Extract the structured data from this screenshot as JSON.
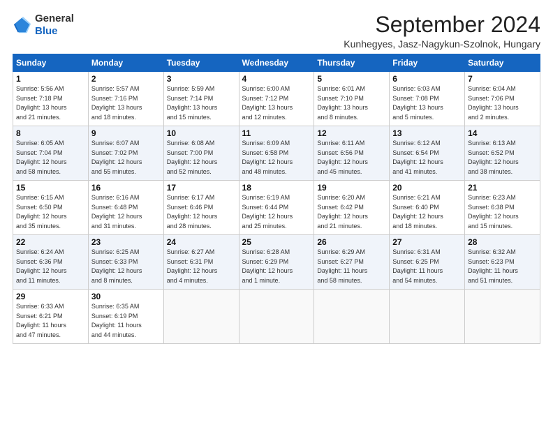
{
  "logo": {
    "line1": "General",
    "line2": "Blue"
  },
  "title": "September 2024",
  "location": "Kunhegyes, Jasz-Nagykun-Szolnok, Hungary",
  "days_of_week": [
    "Sunday",
    "Monday",
    "Tuesday",
    "Wednesday",
    "Thursday",
    "Friday",
    "Saturday"
  ],
  "weeks": [
    [
      {
        "day": "1",
        "sunrise": "5:56 AM",
        "sunset": "7:18 PM",
        "daylight": "13 hours and 21 minutes."
      },
      {
        "day": "2",
        "sunrise": "5:57 AM",
        "sunset": "7:16 PM",
        "daylight": "13 hours and 18 minutes."
      },
      {
        "day": "3",
        "sunrise": "5:59 AM",
        "sunset": "7:14 PM",
        "daylight": "13 hours and 15 minutes."
      },
      {
        "day": "4",
        "sunrise": "6:00 AM",
        "sunset": "7:12 PM",
        "daylight": "13 hours and 12 minutes."
      },
      {
        "day": "5",
        "sunrise": "6:01 AM",
        "sunset": "7:10 PM",
        "daylight": "13 hours and 8 minutes."
      },
      {
        "day": "6",
        "sunrise": "6:03 AM",
        "sunset": "7:08 PM",
        "daylight": "13 hours and 5 minutes."
      },
      {
        "day": "7",
        "sunrise": "6:04 AM",
        "sunset": "7:06 PM",
        "daylight": "13 hours and 2 minutes."
      }
    ],
    [
      {
        "day": "8",
        "sunrise": "6:05 AM",
        "sunset": "7:04 PM",
        "daylight": "12 hours and 58 minutes."
      },
      {
        "day": "9",
        "sunrise": "6:07 AM",
        "sunset": "7:02 PM",
        "daylight": "12 hours and 55 minutes."
      },
      {
        "day": "10",
        "sunrise": "6:08 AM",
        "sunset": "7:00 PM",
        "daylight": "12 hours and 52 minutes."
      },
      {
        "day": "11",
        "sunrise": "6:09 AM",
        "sunset": "6:58 PM",
        "daylight": "12 hours and 48 minutes."
      },
      {
        "day": "12",
        "sunrise": "6:11 AM",
        "sunset": "6:56 PM",
        "daylight": "12 hours and 45 minutes."
      },
      {
        "day": "13",
        "sunrise": "6:12 AM",
        "sunset": "6:54 PM",
        "daylight": "12 hours and 41 minutes."
      },
      {
        "day": "14",
        "sunrise": "6:13 AM",
        "sunset": "6:52 PM",
        "daylight": "12 hours and 38 minutes."
      }
    ],
    [
      {
        "day": "15",
        "sunrise": "6:15 AM",
        "sunset": "6:50 PM",
        "daylight": "12 hours and 35 minutes."
      },
      {
        "day": "16",
        "sunrise": "6:16 AM",
        "sunset": "6:48 PM",
        "daylight": "12 hours and 31 minutes."
      },
      {
        "day": "17",
        "sunrise": "6:17 AM",
        "sunset": "6:46 PM",
        "daylight": "12 hours and 28 minutes."
      },
      {
        "day": "18",
        "sunrise": "6:19 AM",
        "sunset": "6:44 PM",
        "daylight": "12 hours and 25 minutes."
      },
      {
        "day": "19",
        "sunrise": "6:20 AM",
        "sunset": "6:42 PM",
        "daylight": "12 hours and 21 minutes."
      },
      {
        "day": "20",
        "sunrise": "6:21 AM",
        "sunset": "6:40 PM",
        "daylight": "12 hours and 18 minutes."
      },
      {
        "day": "21",
        "sunrise": "6:23 AM",
        "sunset": "6:38 PM",
        "daylight": "12 hours and 15 minutes."
      }
    ],
    [
      {
        "day": "22",
        "sunrise": "6:24 AM",
        "sunset": "6:36 PM",
        "daylight": "12 hours and 11 minutes."
      },
      {
        "day": "23",
        "sunrise": "6:25 AM",
        "sunset": "6:33 PM",
        "daylight": "12 hours and 8 minutes."
      },
      {
        "day": "24",
        "sunrise": "6:27 AM",
        "sunset": "6:31 PM",
        "daylight": "12 hours and 4 minutes."
      },
      {
        "day": "25",
        "sunrise": "6:28 AM",
        "sunset": "6:29 PM",
        "daylight": "12 hours and 1 minute."
      },
      {
        "day": "26",
        "sunrise": "6:29 AM",
        "sunset": "6:27 PM",
        "daylight": "11 hours and 58 minutes."
      },
      {
        "day": "27",
        "sunrise": "6:31 AM",
        "sunset": "6:25 PM",
        "daylight": "11 hours and 54 minutes."
      },
      {
        "day": "28",
        "sunrise": "6:32 AM",
        "sunset": "6:23 PM",
        "daylight": "11 hours and 51 minutes."
      }
    ],
    [
      {
        "day": "29",
        "sunrise": "6:33 AM",
        "sunset": "6:21 PM",
        "daylight": "11 hours and 47 minutes."
      },
      {
        "day": "30",
        "sunrise": "6:35 AM",
        "sunset": "6:19 PM",
        "daylight": "11 hours and 44 minutes."
      },
      null,
      null,
      null,
      null,
      null
    ]
  ]
}
